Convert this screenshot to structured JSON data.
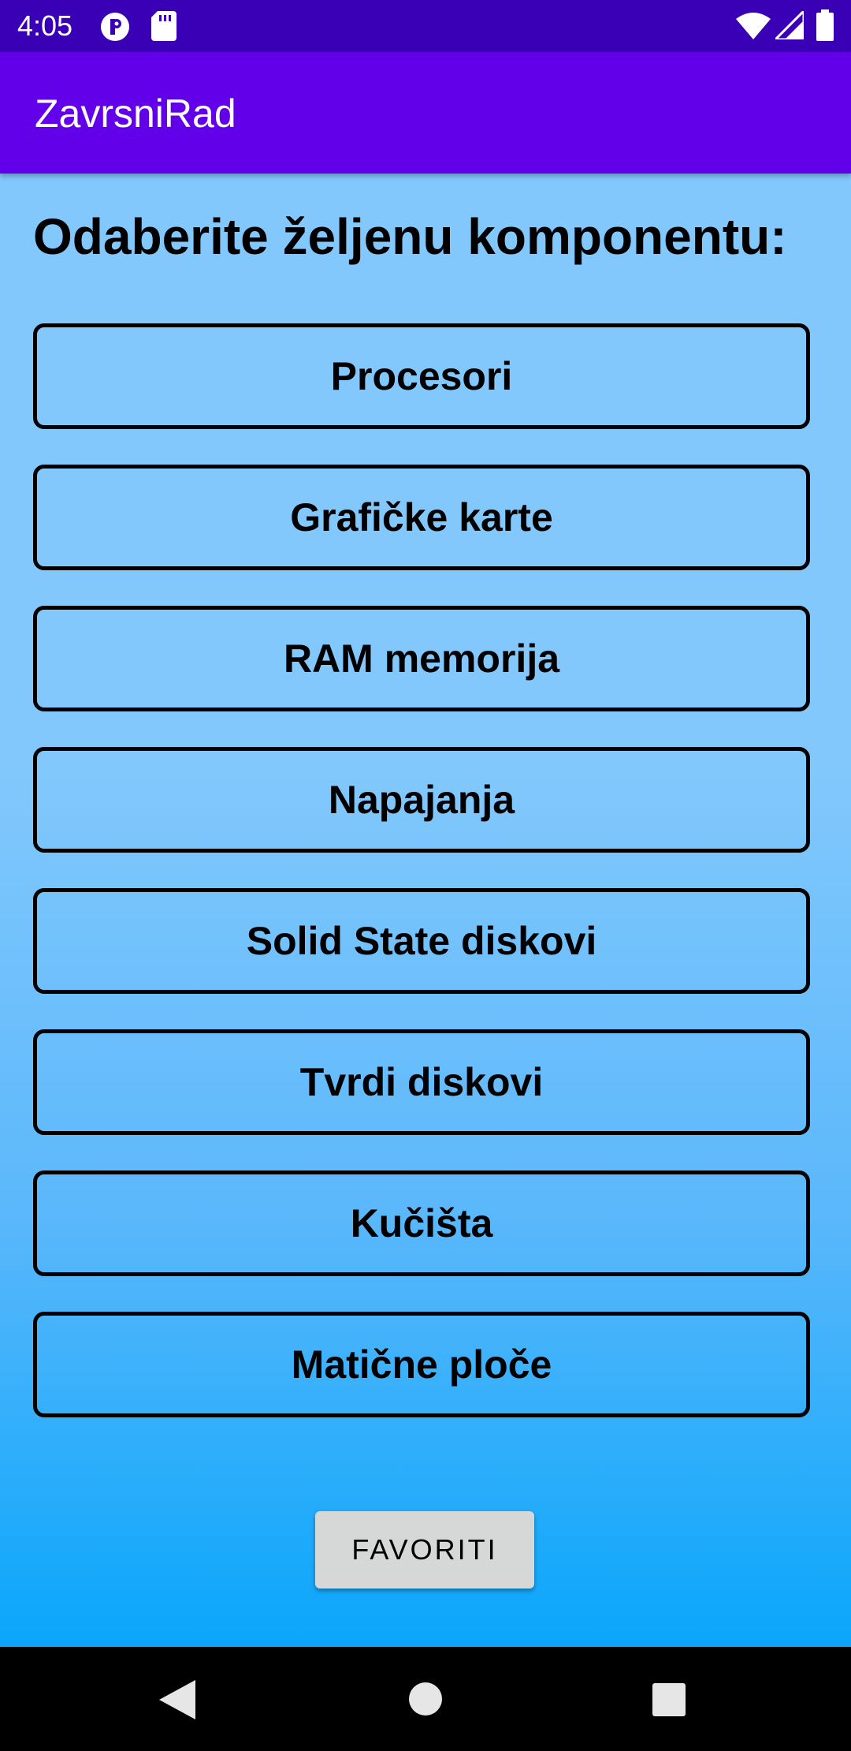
{
  "status_bar": {
    "time": "4:05",
    "icons": [
      "notification-p-icon",
      "sd-card-icon",
      "wifi-icon",
      "signal-icon",
      "battery-icon"
    ]
  },
  "app_bar": {
    "title": "ZavrsniRad"
  },
  "main": {
    "heading": "Odaberite željenu komponentu:",
    "components": [
      {
        "label": "Procesori"
      },
      {
        "label": "Grafičke karte"
      },
      {
        "label": "RAM memorija"
      },
      {
        "label": "Napajanja"
      },
      {
        "label": "Solid State diskovi"
      },
      {
        "label": "Tvrdi diskovi"
      },
      {
        "label": "Kučišta"
      },
      {
        "label": "Matične ploče"
      }
    ],
    "favorites_label": "FAVORITI"
  },
  "nav_bar": {
    "icons": [
      "back-icon",
      "home-icon",
      "recents-icon"
    ]
  },
  "colors": {
    "status_bar": "#3a00b5",
    "app_bar": "#6200ea",
    "content_top": "#82c8fc",
    "content_bottom": "#0aa6fb",
    "button_border": "#000000",
    "favorites_bg": "#d6d7d7"
  }
}
